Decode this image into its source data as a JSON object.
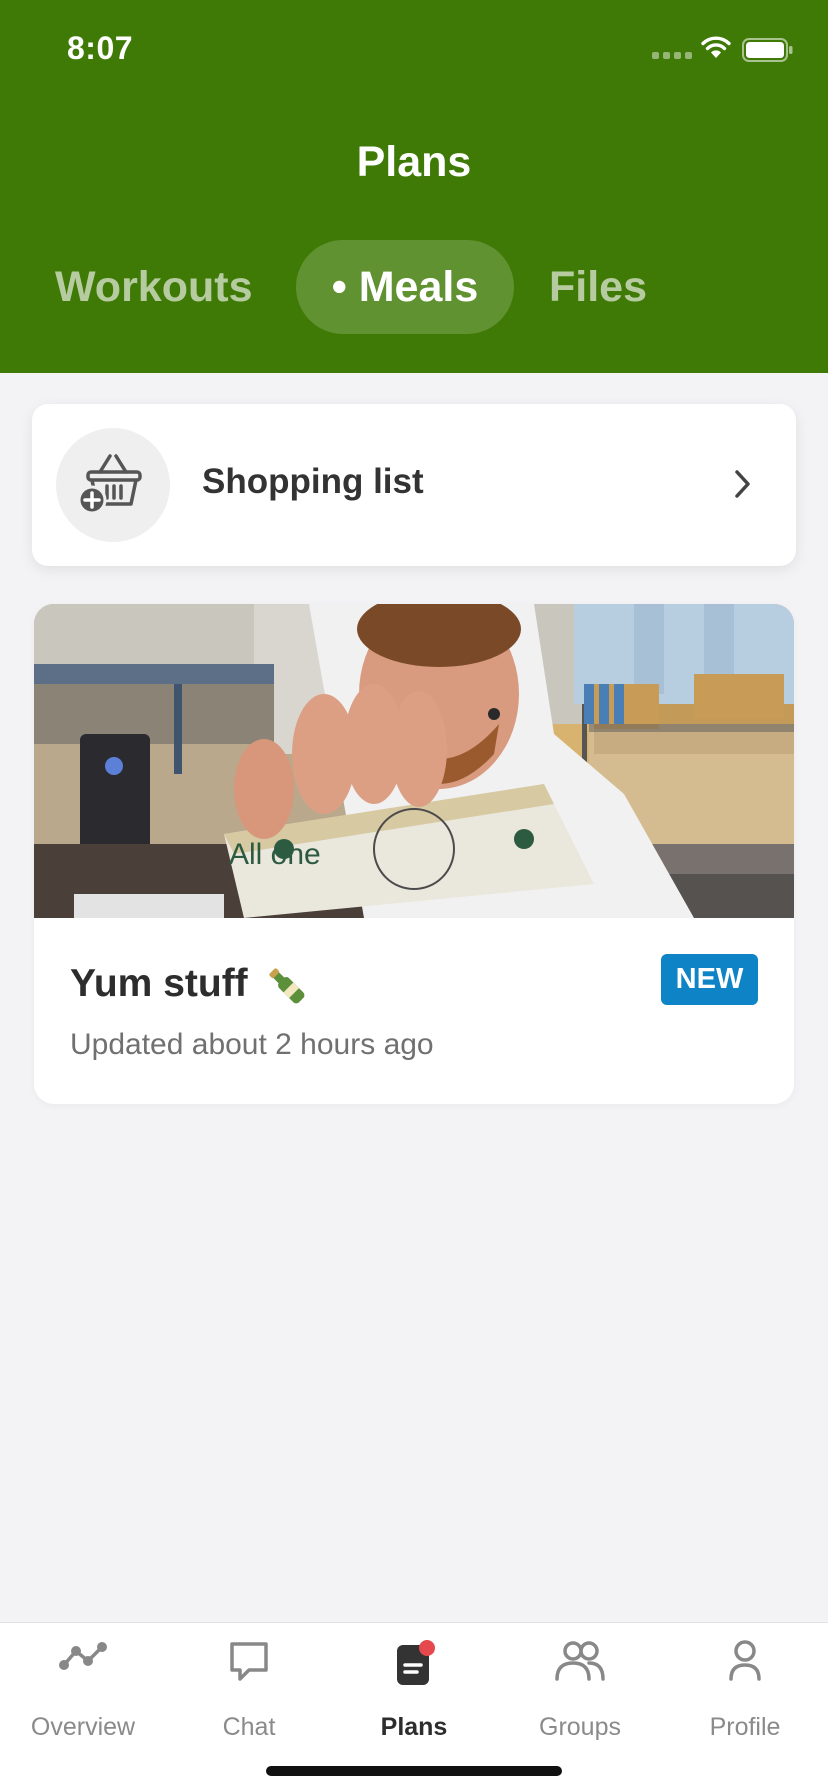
{
  "status_bar": {
    "time": "8:07"
  },
  "header": {
    "title": "Plans",
    "tabs": [
      {
        "label": "Workouts",
        "active": false
      },
      {
        "label": "• Meals",
        "active": true
      },
      {
        "label": "Files",
        "active": false
      }
    ]
  },
  "shopping_list": {
    "label": "Shopping list",
    "icon": "basket-add-icon"
  },
  "meal_plan": {
    "title": "Yum stuff",
    "emoji_icon": "bottle-icon",
    "updated": "Updated about 2 hours ago",
    "badge": "NEW",
    "photo_text": "All one"
  },
  "bottom_nav": {
    "items": [
      {
        "label": "Overview",
        "icon": "activity-graph-icon",
        "active": false
      },
      {
        "label": "Chat",
        "icon": "chat-bubble-icon",
        "active": false
      },
      {
        "label": "Plans",
        "icon": "plans-document-icon",
        "active": true
      },
      {
        "label": "Groups",
        "icon": "groups-icon",
        "active": false
      },
      {
        "label": "Profile",
        "icon": "profile-icon",
        "active": false
      }
    ]
  },
  "colors": {
    "brand_green": "#3f7a06",
    "badge_blue": "#0e83c6",
    "notification_red": "#e5484d",
    "background": "#f3f3f5"
  }
}
